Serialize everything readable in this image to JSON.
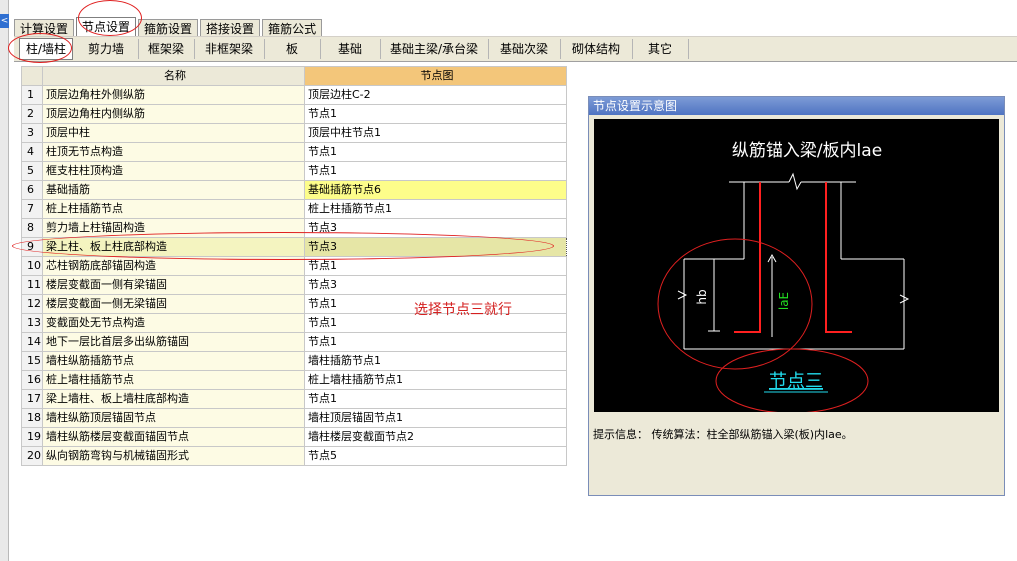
{
  "tabs": [
    "计算设置",
    "节点设置",
    "箍筋设置",
    "搭接设置",
    "箍筋公式"
  ],
  "subtabs": [
    "柱/墙柱",
    "剪力墙",
    "框架梁",
    "非框架梁",
    "板",
    "基础",
    "基础主梁/承台梁",
    "基础次梁",
    "砌体结构",
    "其它"
  ],
  "grid": {
    "col_name": "名称",
    "col_node": "节点图",
    "rows": [
      {
        "n": "1",
        "name": "顶层边角柱外侧纵筋",
        "node": "顶层边柱C-2"
      },
      {
        "n": "2",
        "name": "顶层边角柱内侧纵筋",
        "node": "节点1"
      },
      {
        "n": "3",
        "name": "顶层中柱",
        "node": "顶层中柱节点1"
      },
      {
        "n": "4",
        "name": "柱顶无节点构造",
        "node": "节点1"
      },
      {
        "n": "5",
        "name": "框支柱柱顶构造",
        "node": "节点1"
      },
      {
        "n": "6",
        "name": "基础插筋",
        "node": "基础插筋节点6"
      },
      {
        "n": "7",
        "name": "桩上柱插筋节点",
        "node": "桩上柱插筋节点1"
      },
      {
        "n": "8",
        "name": "剪力墙上柱锚固构造",
        "node": "节点3"
      },
      {
        "n": "9",
        "name": "梁上柱、板上柱底部构造",
        "node": "节点3"
      },
      {
        "n": "10",
        "name": "芯柱钢筋底部锚固构造",
        "node": "节点1"
      },
      {
        "n": "11",
        "name": "楼层变截面一侧有梁锚固",
        "node": "节点3"
      },
      {
        "n": "12",
        "name": "楼层变截面一侧无梁锚固",
        "node": "节点1"
      },
      {
        "n": "13",
        "name": "变截面处无节点构造",
        "node": "节点1"
      },
      {
        "n": "14",
        "name": "地下一层比首层多出纵筋锚固",
        "node": "节点1"
      },
      {
        "n": "15",
        "name": "墙柱纵筋插筋节点",
        "node": "墙柱插筋节点1"
      },
      {
        "n": "16",
        "name": "桩上墙柱插筋节点",
        "node": "桩上墙柱插筋节点1"
      },
      {
        "n": "17",
        "name": "梁上墙柱、板上墙柱底部构造",
        "node": "节点1"
      },
      {
        "n": "18",
        "name": "墙柱纵筋顶层锚固节点",
        "node": "墙柱顶层锚固节点1"
      },
      {
        "n": "19",
        "name": "墙柱纵筋楼层变截面锚固节点",
        "node": "墙柱楼层变截面节点2"
      },
      {
        "n": "20",
        "name": "纵向钢筋弯钩与机械锚固形式",
        "node": "节点5"
      }
    ]
  },
  "annotation": "选择节点三就行",
  "panel": {
    "title": "节点设置示意图",
    "diagram_title": "纵筋锚入梁/板内lae",
    "label_hb": "hb",
    "label_lae": "laE",
    "node_caption": "节点三",
    "tip_label": "提示信息：",
    "tip_text": "传统算法：柱全部纵筋锚入梁(板)内lae。"
  },
  "colors": {
    "highlight_yellow": "#fdfd8a",
    "selected_row": "#e6e6a6",
    "annotation_red": "#d42020",
    "canvas_bg": "#000000",
    "rebar_red": "#ff2020"
  }
}
